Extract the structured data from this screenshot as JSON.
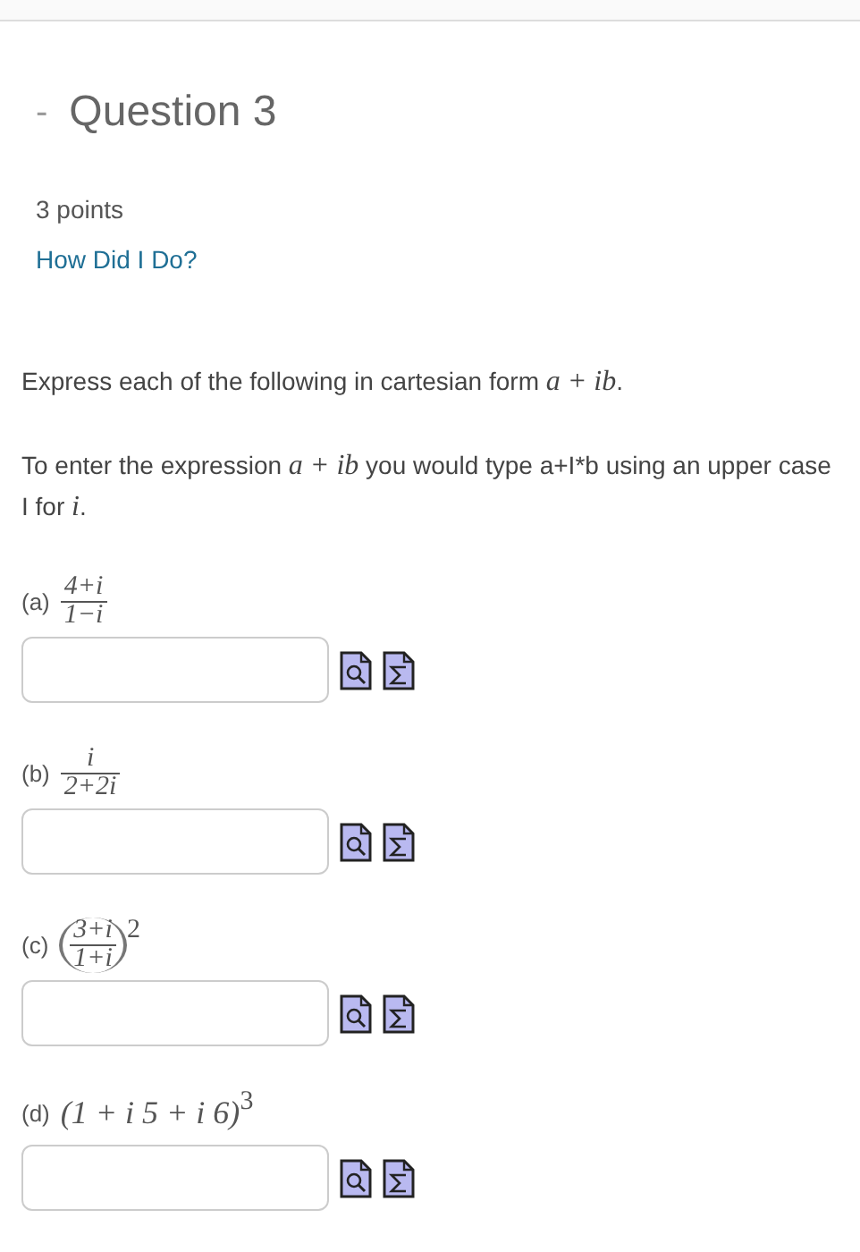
{
  "question": {
    "collapse_mark": "-",
    "title": "Question 3",
    "points": "3 points",
    "feedback_link": "How Did I Do?"
  },
  "instructions": [
    [
      {
        "kind": "text",
        "text": "Express each of the following in cartesian form "
      },
      {
        "kind": "math",
        "text": "a + ib"
      },
      {
        "kind": "text",
        "text": "."
      }
    ],
    [
      {
        "kind": "text",
        "text": "To enter the expression "
      },
      {
        "kind": "math",
        "text": "a + ib"
      },
      {
        "kind": "text",
        "text": " you would type a+I*b using an upper case I for "
      },
      {
        "kind": "math",
        "text": "i"
      },
      {
        "kind": "text",
        "text": "."
      }
    ]
  ],
  "parts": [
    {
      "label": "(a)",
      "kind": "fraction",
      "numerator": "4+i",
      "denominator": "1−i"
    },
    {
      "label": "(b)",
      "kind": "fraction",
      "numerator": "i",
      "denominator": "2+2i"
    },
    {
      "label": "(c)",
      "kind": "power_fraction",
      "numerator": "3+i",
      "denominator": "1+i",
      "exponent": "2"
    },
    {
      "label": "(d)",
      "kind": "power",
      "base": "(1 + i 5 + i 6)",
      "exponent": "3"
    }
  ]
}
